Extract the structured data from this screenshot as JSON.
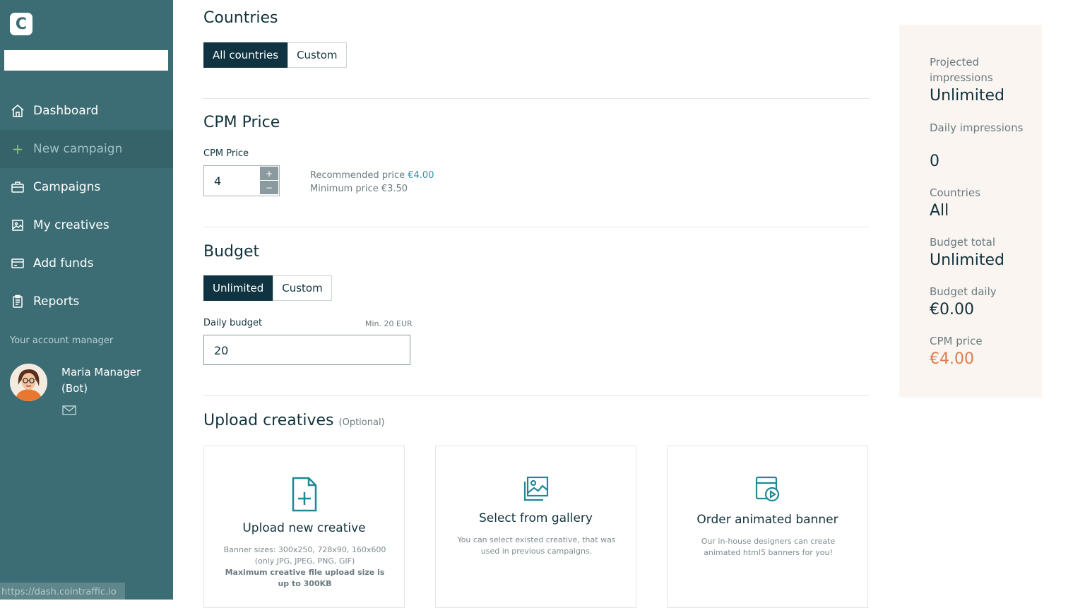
{
  "sidebar": {
    "logo_letter": "C",
    "nav": [
      {
        "label": "Dashboard",
        "icon": "home-icon"
      },
      {
        "label": "New campaign",
        "icon": "plus-icon",
        "active": true
      },
      {
        "label": "Campaigns",
        "icon": "briefcase-icon"
      },
      {
        "label": "My creatives",
        "icon": "image-icon"
      },
      {
        "label": "Add funds",
        "icon": "credit-card-icon"
      },
      {
        "label": "Reports",
        "icon": "clipboard-icon"
      }
    ],
    "account_manager_label": "Your account manager",
    "manager_name": "Maria Manager (Bot)",
    "status_url": "https://dash.cointraffic.io"
  },
  "countries": {
    "title": "Countries",
    "options": [
      "All countries",
      "Custom"
    ],
    "selected": "All countries"
  },
  "cpm": {
    "title": "CPM Price",
    "field_label": "CPM Price",
    "value": "4",
    "plus": "+",
    "minus": "−",
    "recommended_label": "Recommended price",
    "recommended_value": "€4.00",
    "minimum_text": "Minimum price €3.50"
  },
  "budget": {
    "title": "Budget",
    "options": [
      "Unlimited",
      "Custom"
    ],
    "selected": "Unlimited",
    "daily_label": "Daily budget",
    "min_hint": "Min. 20 EUR",
    "daily_value": "20"
  },
  "upload": {
    "title": "Upload creatives",
    "optional": "(Optional)",
    "cards": [
      {
        "title": "Upload new creative",
        "icon": "file-plus-icon",
        "desc": "Banner sizes: 300x250, 728x90, 160x600 (only JPG, JPEG, PNG, GIF)",
        "desc_bold": "Maximum creative file upload size is up to 300KB"
      },
      {
        "title": "Select from gallery",
        "icon": "gallery-icon",
        "desc": "You can select existed creative, that was used in previous campaigns."
      },
      {
        "title": "Order animated banner",
        "icon": "animated-banner-icon",
        "desc": "Our in-house designers can create animated html5 banners for you!"
      }
    ]
  },
  "summary": {
    "projected_label": "Projected impressions",
    "projected_value": "Unlimited",
    "daily_label": "Daily impressions",
    "daily_value": "0",
    "countries_label": "Countries",
    "countries_value": "All",
    "budget_total_label": "Budget total",
    "budget_total_value": "Unlimited",
    "budget_daily_label": "Budget daily",
    "budget_daily_value": "€0.00",
    "cpm_label": "CPM price",
    "cpm_value": "€4.00"
  },
  "colors": {
    "sidebar": "#3d6d74",
    "dark": "#0f3340",
    "accent": "#1e9aa5",
    "orange": "#e07b4d",
    "summary_bg": "#faf5f1"
  }
}
